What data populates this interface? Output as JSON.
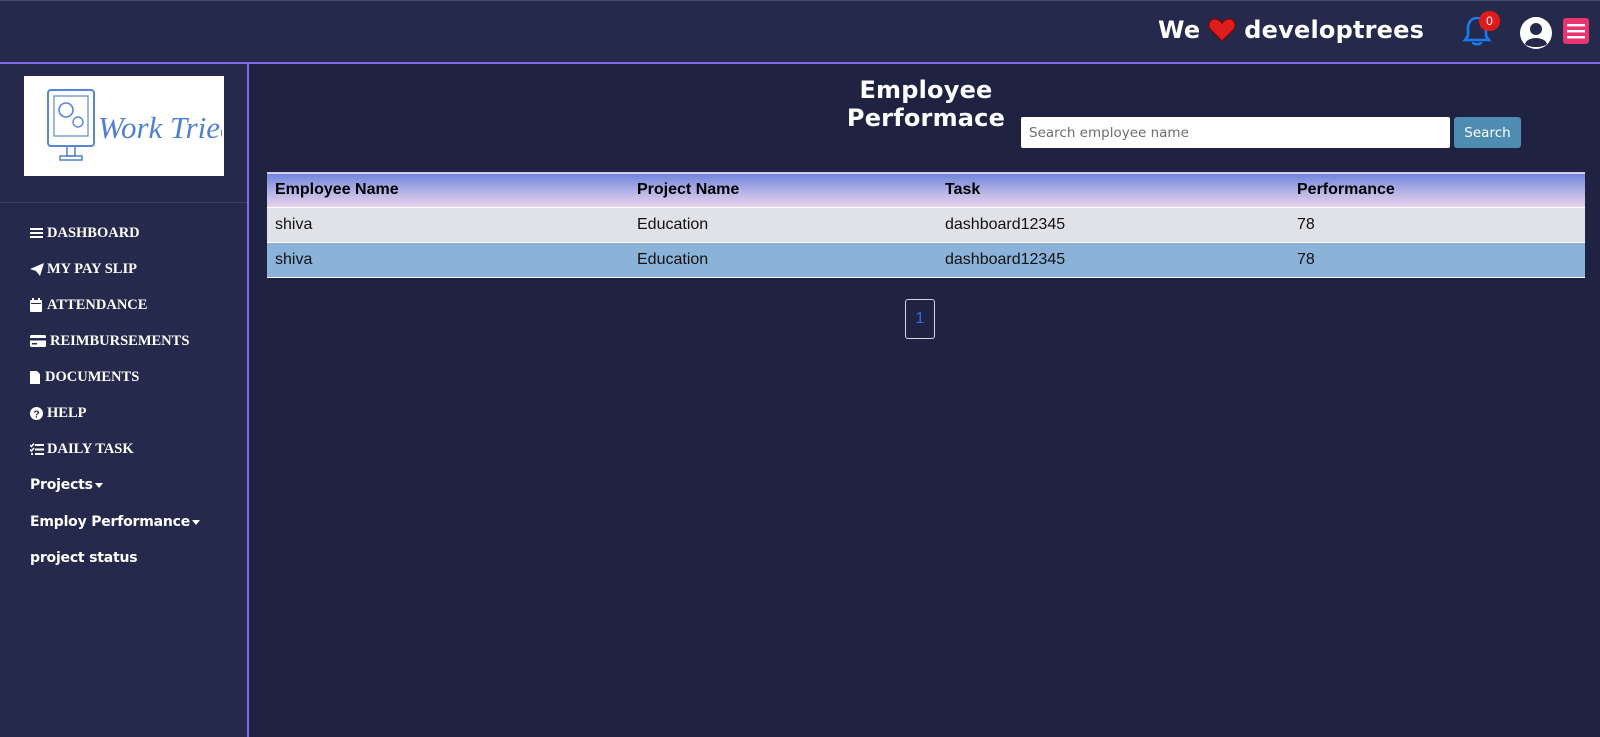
{
  "header": {
    "brand_prefix": "We",
    "brand_name": "developtrees",
    "notification_count": "0",
    "icons": [
      "heart-icon",
      "bell-icon",
      "user-circle-icon",
      "menu-icon"
    ],
    "accent_colors": {
      "bell": "#1a7cf5",
      "badge": "#e11b1b",
      "menu": "#e8346f"
    }
  },
  "sidebar": {
    "logo_text": "Work Tried",
    "items": [
      {
        "label": "DASHBOARD",
        "icon": "bars-icon"
      },
      {
        "label": "MY PAY SLIP",
        "icon": "paper-plane-icon"
      },
      {
        "label": "ATTENDANCE",
        "icon": "calendar-icon"
      },
      {
        "label": "REIMBURSEMENTS",
        "icon": "credit-card-icon"
      },
      {
        "label": "DOCUMENTS",
        "icon": "file-icon"
      },
      {
        "label": "HELP",
        "icon": "question-circle-icon"
      },
      {
        "label": "DAILY TASK",
        "icon": "list-check-icon"
      },
      {
        "label": "Projects",
        "icon": "caret-down-icon"
      },
      {
        "label": "Employ Performance",
        "icon": "caret-down-icon"
      },
      {
        "label": "project status"
      }
    ]
  },
  "main": {
    "title": "Employee Performace",
    "search": {
      "placeholder": "Search employee name",
      "value": "",
      "button_label": "Search"
    },
    "table": {
      "columns": [
        "Employee Name",
        "Project Name",
        "Task",
        "Performance"
      ],
      "rows": [
        [
          "shiva",
          "Education",
          "dashboard12345",
          "78"
        ],
        [
          "shiva",
          "Education",
          "dashboard12345",
          "78"
        ]
      ]
    },
    "pagination": {
      "current_page": "1"
    }
  }
}
